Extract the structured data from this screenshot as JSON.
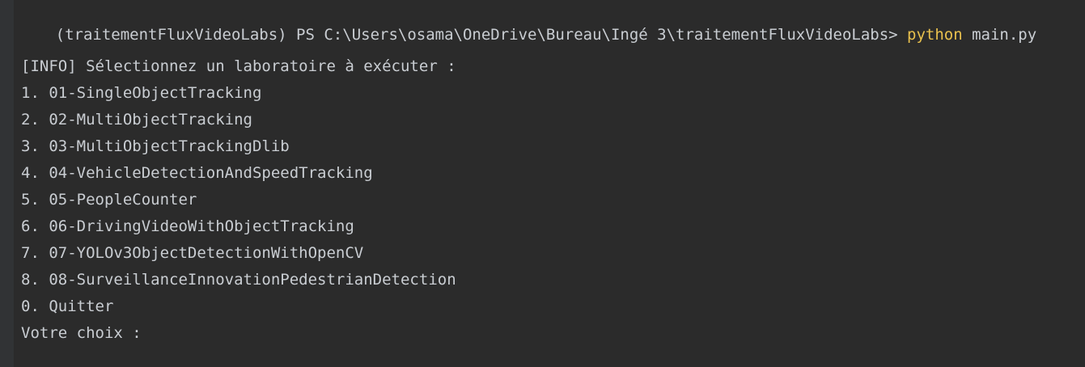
{
  "terminal": {
    "prompt": "(traitementFluxVideoLabs) PS C:\\Users\\osama\\OneDrive\\Bureau\\Ingé 3\\traitementFluxVideoLabs> ",
    "command_program": "python",
    "command_args": " main.py",
    "info_line": "[INFO] Sélectionnez un laboratoire à exécuter :",
    "menu": [
      "1. 01-SingleObjectTracking",
      "2. 02-MultiObjectTracking",
      "3. 03-MultiObjectTrackingDlib",
      "4. 04-VehicleDetectionAndSpeedTracking",
      "5. 05-PeopleCounter",
      "6. 06-DrivingVideoWithObjectTracking",
      "7. 07-YOLOv3ObjectDetectionWithOpenCV",
      "8. 08-SurveillanceInnovationPedestrianDetection",
      "0. Quitter"
    ],
    "input_prompt": "Votre choix : "
  },
  "colors": {
    "background": "#2b2b2b",
    "text": "#c9cdd2",
    "command_highlight": "#e8c04d"
  }
}
